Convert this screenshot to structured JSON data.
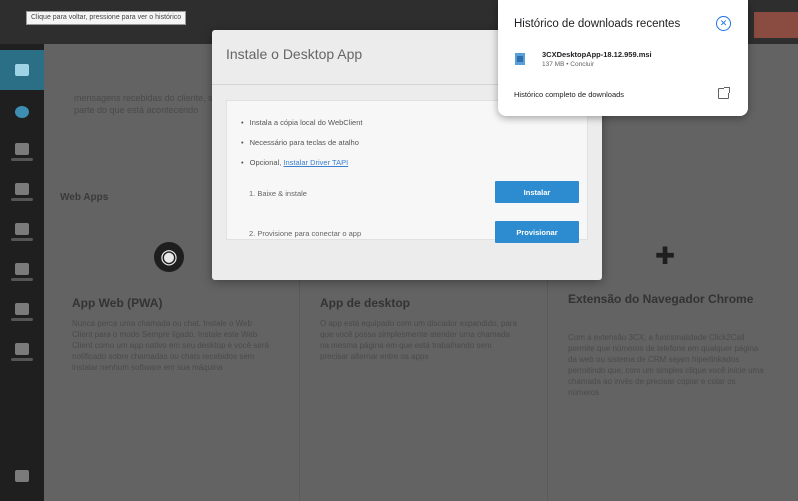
{
  "browser": {
    "back_tooltip": "Clique para voltar, pressione para ver o histórico"
  },
  "main": {
    "intro_text": "mensagens recebidas do cliente, sobre a parte do que está acontecendo",
    "section_title": "Web Apps",
    "cards": [
      {
        "icon": "chrome-icon",
        "title": "App Web (PWA)",
        "description": "Nunca perca uma chamada ou chat. Instale o Web Client para o modo Sempre ligado. Instale este Web Client como um app nativo em seu desktop e você será notificado sobre chamadas ou chats recebidos sem instalar nenhum software em sua máquina"
      },
      {
        "icon": "desktop-app-icon",
        "title": "App de desktop",
        "description": "O app está equipado com um discador expandido, para que você possa simplesmente atender uma chamada na mesma página em que está trabalhando sem precisar alternar entre os apps"
      },
      {
        "icon": "puzzle-icon",
        "title": "Extensão do Navegador Chrome",
        "description": "Com a extensão 3CX, a funcionalidade Click2Call permite que números de telefone em qualquer página da web ou sistema de CRM sejam hiperlinkados permitindo que, com um simples clique você inicie uma chamada ao invés de precisar copiar e colar os números"
      }
    ]
  },
  "modal": {
    "title": "Instale o Desktop App",
    "bullets": {
      "b1": "Instala a cópia local do WebClient",
      "b2": "Necessário para teclas de atalho",
      "b3_prefix": "Opcional, ",
      "b3_link": "Instalar Driver TAPI"
    },
    "step1_text": "1. Baixe & instale",
    "step1_button": "Instalar",
    "step2_text": "2. Provisione para conectar o app",
    "step2_button": "Provisionar"
  },
  "downloads": {
    "title": "Histórico de downloads recentes",
    "file_name": "3CXDesktopApp-18.12.959.msi",
    "file_meta": "137 MB • Concluir",
    "history_link": "Histórico completo de downloads"
  },
  "colors": {
    "accent": "#2c8ccf",
    "chrome_accent": "#1a73e8"
  }
}
